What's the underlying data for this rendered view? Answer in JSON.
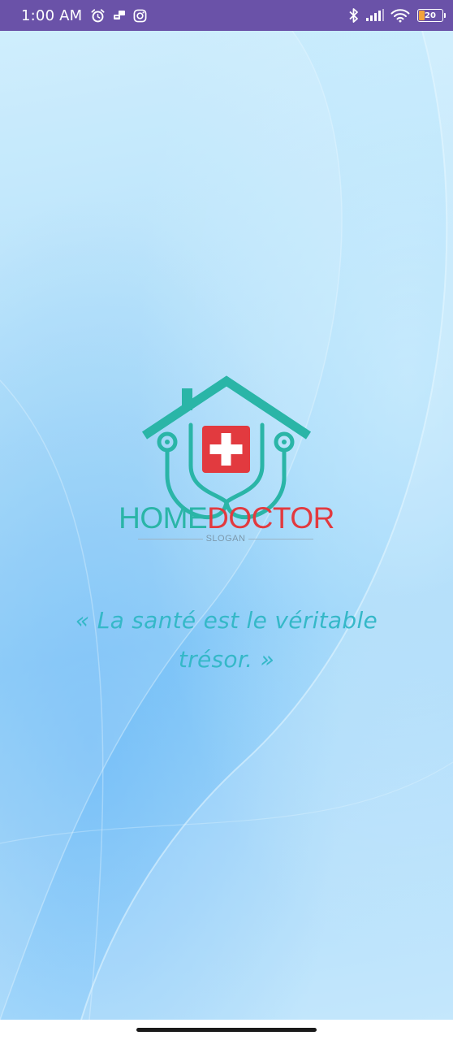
{
  "status_bar": {
    "time": "1:00 AM",
    "battery_level": "20",
    "background_color": "#6a52a8",
    "left_icons": [
      "alarm-icon",
      "notification-icon",
      "instagram-icon"
    ],
    "right_icons": [
      "bluetooth-icon",
      "signal-icon",
      "wifi-icon",
      "battery-icon"
    ]
  },
  "splash": {
    "brand_home": "HOME",
    "brand_doctor": "DOCTOR",
    "slogan": "SLOGAN",
    "quote_line1": "« La santé est le véritable",
    "quote_line2": "trésor. »",
    "brand_colors": {
      "teal": "#2ab5a7",
      "red": "#e23a3f"
    },
    "logo_icon": "house-stethoscope-medical-cross-logo"
  }
}
